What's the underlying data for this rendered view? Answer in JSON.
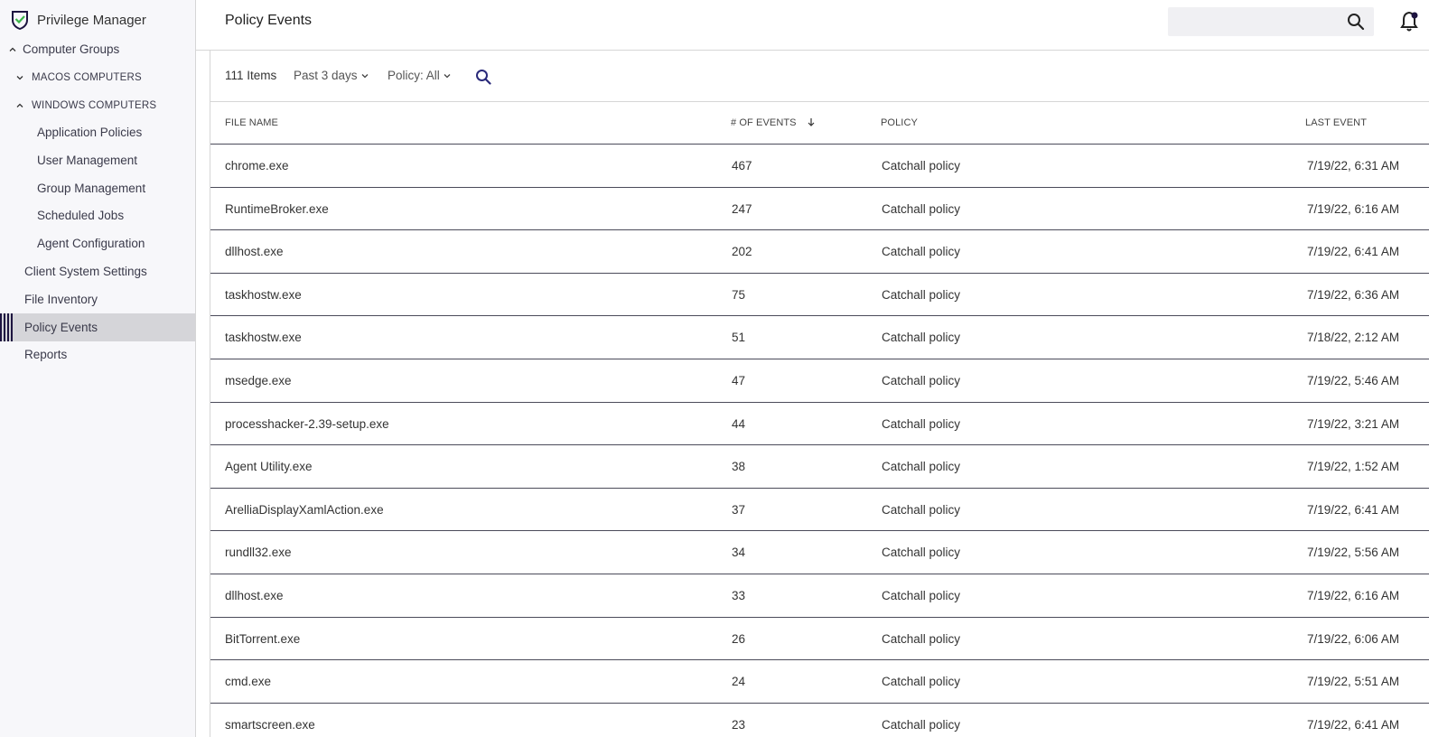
{
  "app": {
    "name": "Privilege Manager"
  },
  "sidebar": {
    "items": [
      {
        "label": "Computer Groups",
        "chevron": "up"
      },
      {
        "label": "MACOS COMPUTERS",
        "chevron": "down"
      },
      {
        "label": "WINDOWS COMPUTERS",
        "chevron": "up"
      },
      {
        "label": "Application Policies"
      },
      {
        "label": "User Management"
      },
      {
        "label": "Group Management"
      },
      {
        "label": "Scheduled Jobs"
      },
      {
        "label": "Agent Configuration"
      },
      {
        "label": "Client System Settings"
      },
      {
        "label": "File Inventory"
      },
      {
        "label": "Policy Events",
        "active": true
      },
      {
        "label": "Reports"
      }
    ]
  },
  "header": {
    "title": "Policy Events",
    "search_placeholder": "",
    "search_icon": "search-icon",
    "notification_icon": "bell-icon"
  },
  "toolbar": {
    "count": "111 Items",
    "date_filter": "Past 3 days",
    "policy_filter": "Policy: All",
    "search_icon": "search-icon"
  },
  "table": {
    "columns": [
      "FILE NAME",
      "# OF EVENTS",
      "POLICY",
      "LAST EVENT"
    ],
    "sorted_column": "# OF EVENTS",
    "sort_direction": "descending",
    "rows": [
      {
        "file": "chrome.exe",
        "events": "467",
        "policy": "Catchall policy",
        "last": "7/19/22, 6:31 AM"
      },
      {
        "file": "RuntimeBroker.exe",
        "events": "247",
        "policy": "Catchall policy",
        "last": "7/19/22, 6:16 AM"
      },
      {
        "file": "dllhost.exe",
        "events": "202",
        "policy": "Catchall policy",
        "last": "7/19/22, 6:41 AM"
      },
      {
        "file": "taskhostw.exe",
        "events": "75",
        "policy": "Catchall policy",
        "last": "7/19/22, 6:36 AM"
      },
      {
        "file": "taskhostw.exe",
        "events": "51",
        "policy": "Catchall policy",
        "last": "7/18/22, 2:12 AM"
      },
      {
        "file": "msedge.exe",
        "events": "47",
        "policy": "Catchall policy",
        "last": "7/19/22, 5:46 AM"
      },
      {
        "file": "processhacker-2.39-setup.exe",
        "events": "44",
        "policy": "Catchall policy",
        "last": "7/19/22, 3:21 AM"
      },
      {
        "file": "Agent Utility.exe",
        "events": "38",
        "policy": "Catchall policy",
        "last": "7/19/22, 1:52 AM"
      },
      {
        "file": "ArelliaDisplayXamlAction.exe",
        "events": "37",
        "policy": "Catchall policy",
        "last": "7/19/22, 6:41 AM"
      },
      {
        "file": "rundll32.exe",
        "events": "34",
        "policy": "Catchall policy",
        "last": "7/19/22, 5:56 AM"
      },
      {
        "file": "dllhost.exe",
        "events": "33",
        "policy": "Catchall policy",
        "last": "7/19/22, 6:16 AM"
      },
      {
        "file": "BitTorrent.exe",
        "events": "26",
        "policy": "Catchall policy",
        "last": "7/19/22, 6:06 AM"
      },
      {
        "file": "cmd.exe",
        "events": "24",
        "policy": "Catchall policy",
        "last": "7/19/22, 5:51 AM"
      },
      {
        "file": "smartscreen.exe",
        "events": "23",
        "policy": "Catchall policy",
        "last": "7/19/22, 6:41 AM"
      }
    ]
  },
  "colors": {
    "accent": "#1d1440",
    "active_bg": "#d5d5d9",
    "sidebar_bg": "#f7f7fa"
  }
}
